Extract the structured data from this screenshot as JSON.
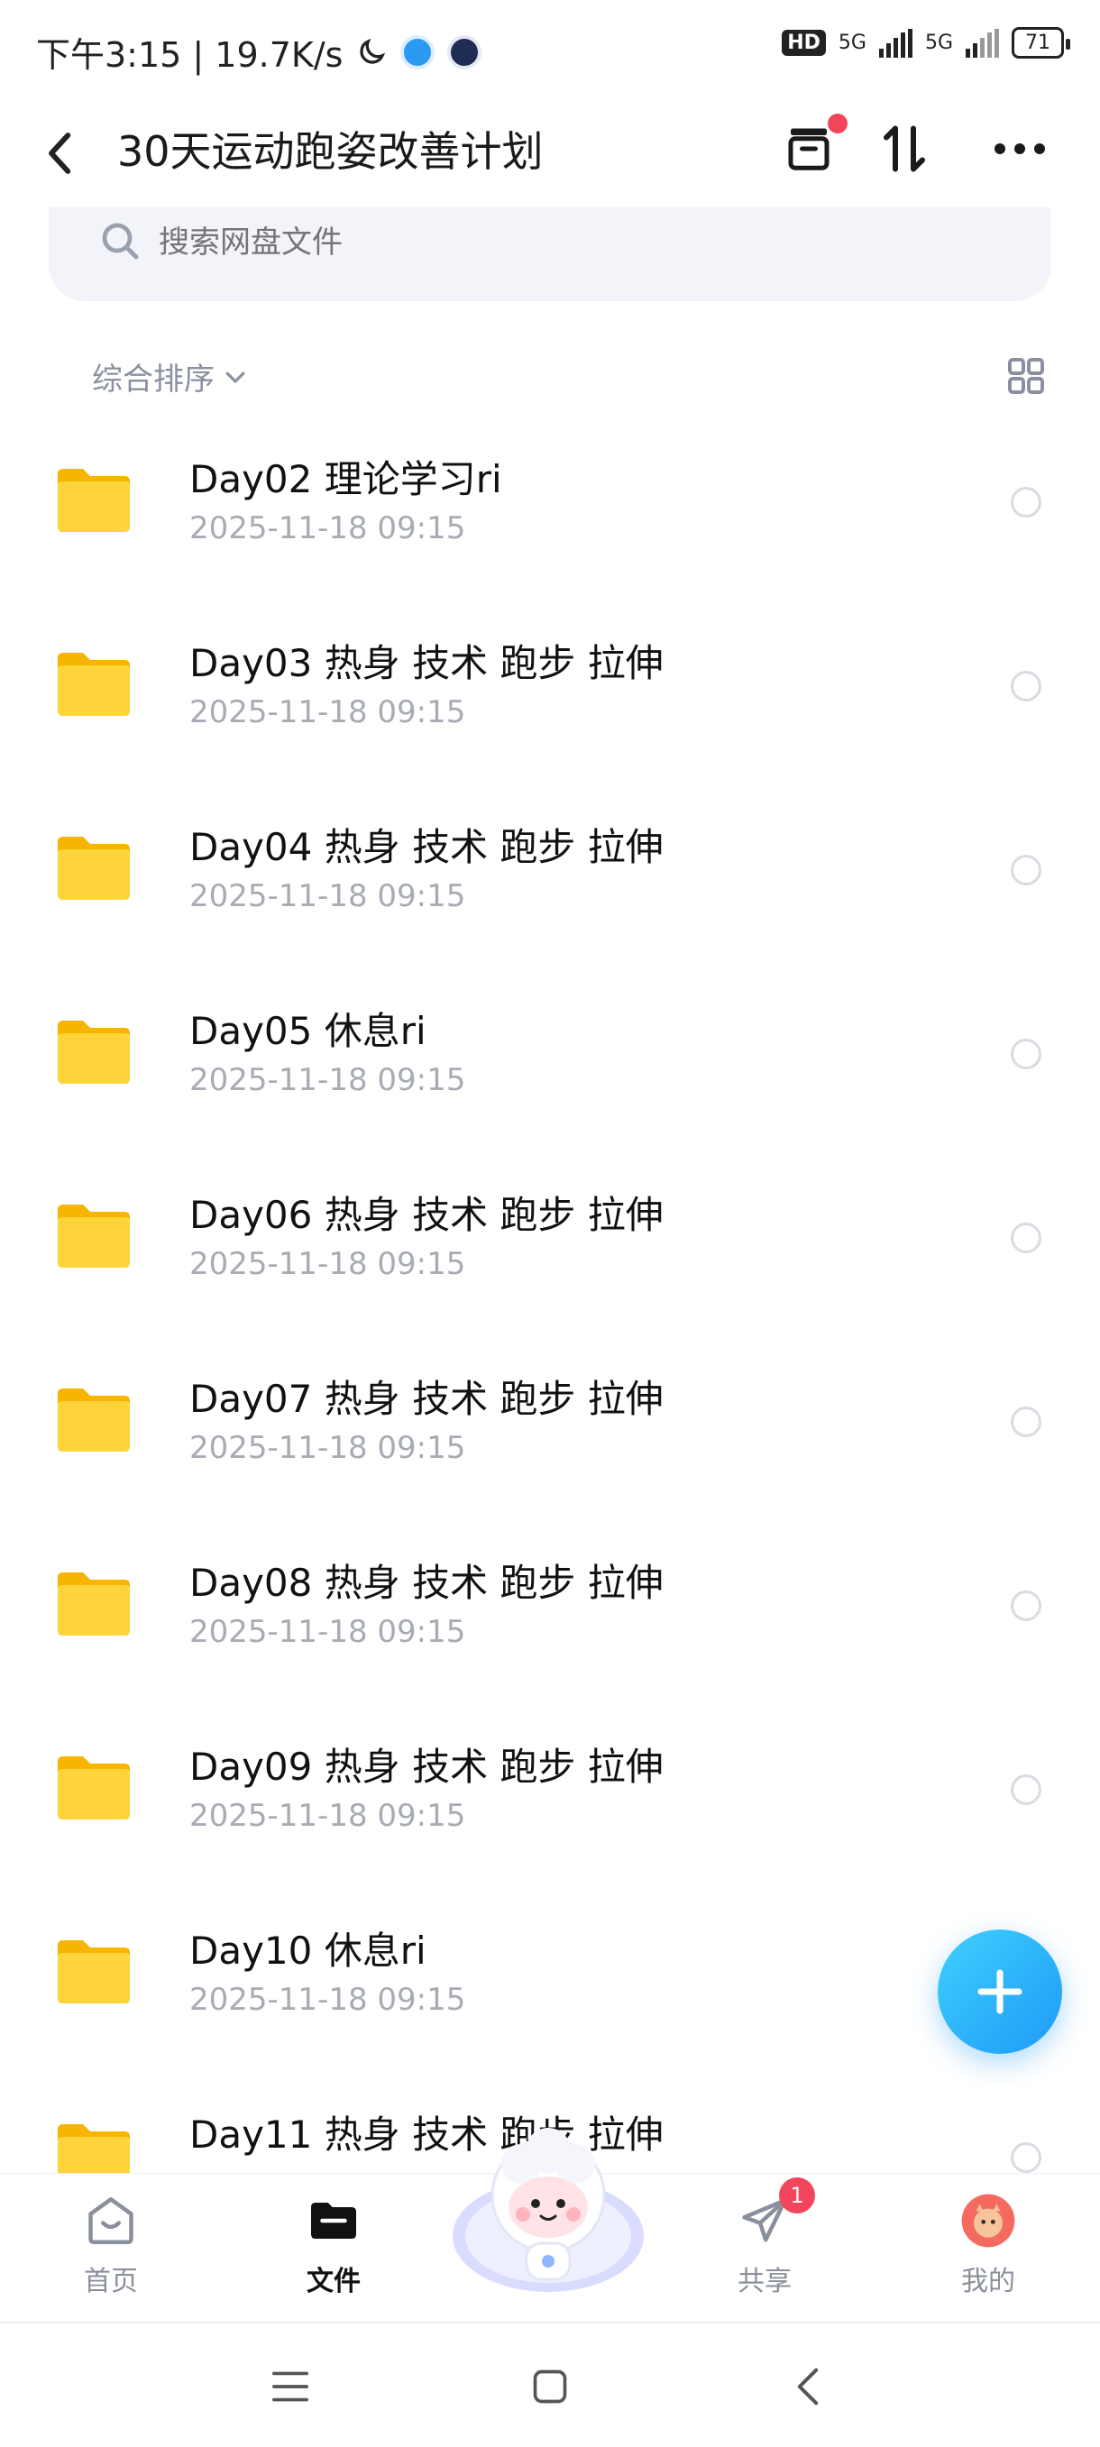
{
  "status_bar": {
    "time_speed": "下午3:15 | 19.7K/s",
    "hd": "HD",
    "net1": "5G",
    "net2": "5G",
    "battery": "71"
  },
  "header": {
    "title": "30天运动跑姿改善计划"
  },
  "search": {
    "placeholder": "搜索网盘文件"
  },
  "sort": {
    "label": "综合排序"
  },
  "files": [
    {
      "name": "Day02 理论学习ri",
      "date": "2025-11-18  09:15"
    },
    {
      "name": "Day03 热身 技术 跑步 拉伸",
      "date": "2025-11-18  09:15"
    },
    {
      "name": "Day04 热身 技术 跑步 拉伸",
      "date": "2025-11-18  09:15"
    },
    {
      "name": "Day05 休息ri",
      "date": "2025-11-18  09:15"
    },
    {
      "name": "Day06 热身 技术 跑步 拉伸",
      "date": "2025-11-18  09:15"
    },
    {
      "name": "Day07 热身 技术 跑步 拉伸",
      "date": "2025-11-18  09:15"
    },
    {
      "name": "Day08 热身 技术 跑步 拉伸",
      "date": "2025-11-18  09:15"
    },
    {
      "name": "Day09 热身 技术 跑步 拉伸",
      "date": "2025-11-18  09:15"
    },
    {
      "name": "Day10 休息ri",
      "date": "2025-11-18  09:15"
    },
    {
      "name": "Day11 热身 技术 跑步 拉伸",
      "date": ""
    }
  ],
  "tabs": {
    "home": "首页",
    "files": "文件",
    "share": "共享",
    "share_badge": "1",
    "mine": "我的"
  },
  "colors": {
    "accent": "#1e9af5",
    "folder": "#ffc928",
    "badge": "#f2455c"
  }
}
